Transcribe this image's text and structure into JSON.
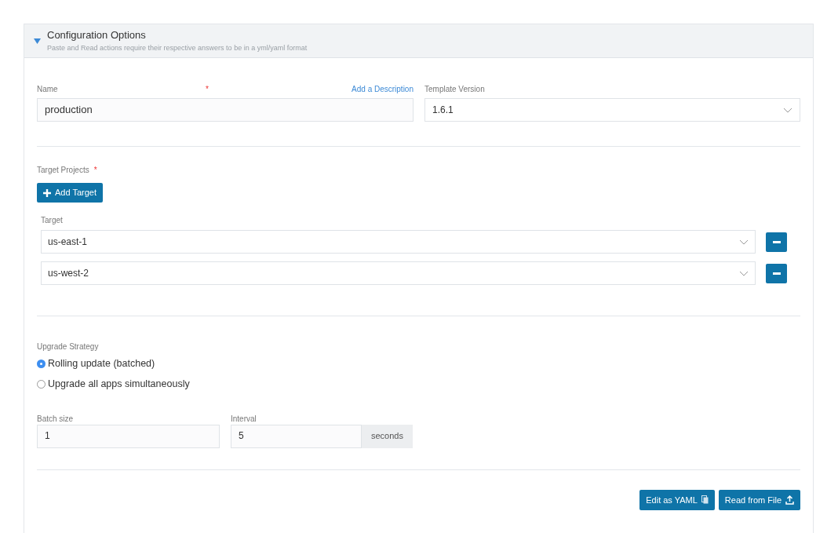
{
  "panel": {
    "title": "Configuration Options",
    "subtitle": "Paste and Read actions require their respective answers to be in a yml/yaml format",
    "expanded": true
  },
  "name_field": {
    "label": "Name",
    "required_mark": "*",
    "value": "production",
    "link": "Add a Description"
  },
  "template_version": {
    "label": "Template Version",
    "value": "1.6.1"
  },
  "target_projects": {
    "label": "Target Projects",
    "required_mark": "*",
    "add_button": "Add Target",
    "column": "Target",
    "rows": [
      {
        "value": "us-east-1"
      },
      {
        "value": "us-west-2"
      }
    ]
  },
  "upgrade_strategy": {
    "label": "Upgrade Strategy",
    "options": [
      {
        "label": "Rolling update (batched)",
        "selected": true
      },
      {
        "label": "Upgrade all apps simultaneously",
        "selected": false
      }
    ]
  },
  "batch_size": {
    "label": "Batch size",
    "value": "1"
  },
  "interval": {
    "label": "Interval",
    "value": "5",
    "unit": "seconds"
  },
  "buttons": [
    {
      "label": "Edit as YAML",
      "kind": "copy"
    },
    {
      "label": "Read from File",
      "kind": "upload"
    }
  ]
}
